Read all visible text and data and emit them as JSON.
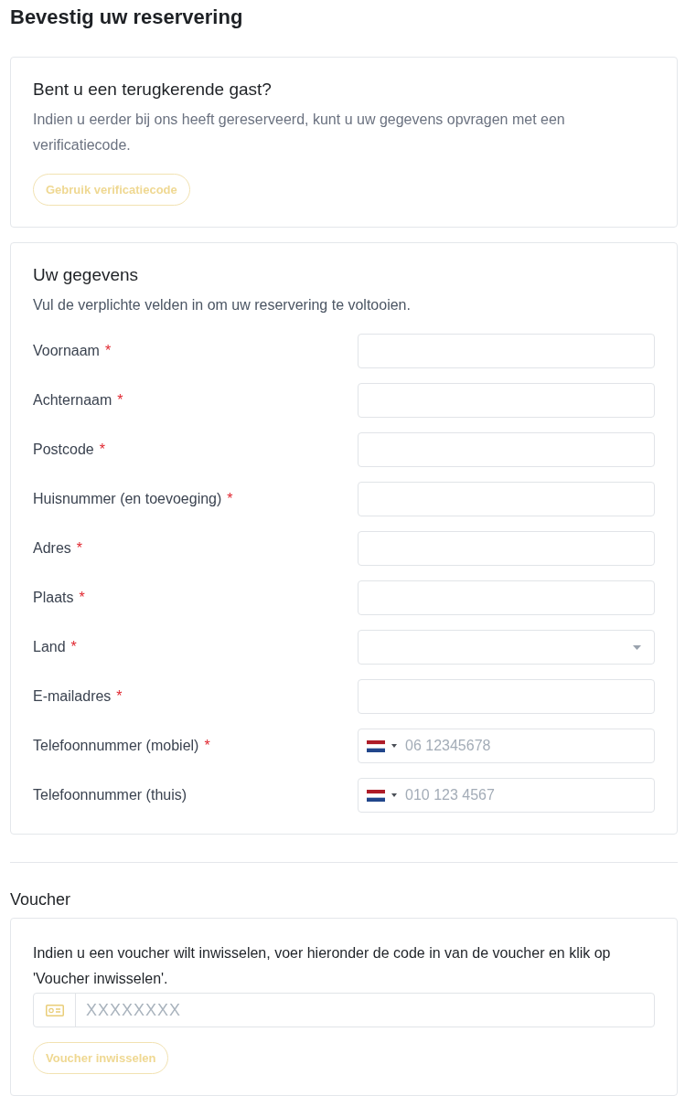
{
  "page": {
    "title": "Bevestig uw reservering"
  },
  "returning_guest": {
    "heading": "Bent u een terugkerende gast?",
    "text": "Indien u eerder bij ons heeft gereserveerd, kunt u uw gegevens opvragen met een verificatiecode.",
    "button": {
      "label": "Gebruik verificatiecode",
      "disabled": true
    }
  },
  "details": {
    "heading": "Uw gegevens",
    "text": "Vul de verplichte velden in om uw reservering te voltooien.",
    "fields": [
      {
        "kind": "text",
        "label": "Voornaam",
        "required_mark": "*"
      },
      {
        "kind": "text",
        "label": "Achternaam",
        "required_mark": "*"
      },
      {
        "kind": "text",
        "label": "Postcode",
        "required_mark": "*"
      },
      {
        "kind": "text",
        "label": "Huisnummer (en toevoeging)",
        "required_mark": "*"
      },
      {
        "kind": "text",
        "label": "Adres",
        "required_mark": "*"
      },
      {
        "kind": "text",
        "label": "Plaats",
        "required_mark": "*"
      },
      {
        "kind": "select",
        "label": "Land",
        "required_mark": "*"
      },
      {
        "kind": "text",
        "label": "E-mailadres",
        "required_mark": "*"
      },
      {
        "kind": "phone",
        "label": "Telefoonnummer (mobiel)",
        "required_mark": "*",
        "placeholder": "06 12345678"
      },
      {
        "kind": "phone",
        "label": "Telefoonnummer (thuis)",
        "placeholder": "010 123 4567"
      }
    ]
  },
  "voucher": {
    "heading": "Voucher",
    "text": "Indien u een voucher wilt inwisselen, voer hieronder de code in van de voucher en klik op 'Voucher inwisselen'.",
    "field": {
      "placeholder": "XXXXXXXX"
    },
    "button": {
      "label": "Voucher inwisselen",
      "disabled": true
    }
  }
}
